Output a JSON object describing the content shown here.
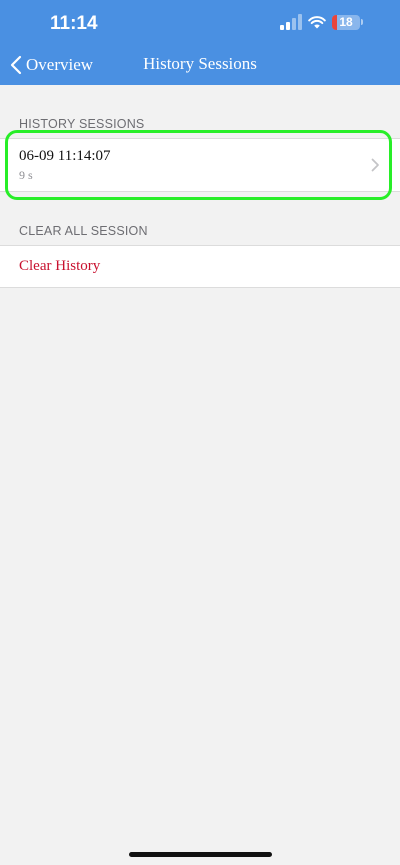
{
  "status_bar": {
    "time": "11:14",
    "battery": "18",
    "battery_level": 0.18,
    "signal_icon": "cellular-signal-icon",
    "wifi_icon": "wifi-icon"
  },
  "nav": {
    "back_label": "Overview",
    "title": "History Sessions",
    "back_icon": "chevron-left-icon"
  },
  "sections": {
    "history_header": "HISTORY SESSIONS",
    "clear_header": "CLEAR ALL SESSION"
  },
  "sessions": [
    {
      "title": "06-09 11:14:07",
      "subtitle": "9 s"
    }
  ],
  "clear_action": {
    "label": "Clear History",
    "color": "#c8102e"
  },
  "colors": {
    "header": "#4a90e2",
    "highlight": "#28ee28",
    "background": "#f2f2f2"
  }
}
